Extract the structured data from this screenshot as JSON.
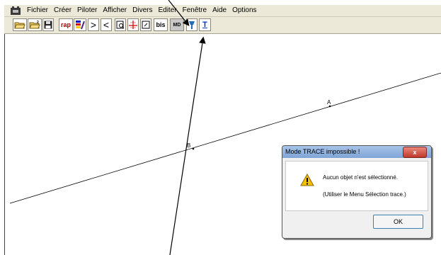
{
  "menubar": {
    "items": [
      "Fichier",
      "Créer",
      "Piloter",
      "Afficher",
      "Divers",
      "Editer",
      "Fenêtre",
      "Aide",
      "Options"
    ]
  },
  "toolbar": {
    "buttons": [
      {
        "name": "open-folder-icon",
        "label": ""
      },
      {
        "name": "open-folder-2-icon",
        "label": ""
      },
      {
        "name": "save-icon",
        "label": ""
      },
      {
        "name": "rap-button",
        "label": "rap"
      },
      {
        "name": "colors-icon",
        "label": ""
      },
      {
        "name": "greater-than-icon",
        "label": ">"
      },
      {
        "name": "less-than-icon",
        "label": "<"
      },
      {
        "name": "page-zoom-icon",
        "label": ""
      },
      {
        "name": "axes-icon",
        "label": ""
      },
      {
        "name": "frame-icon",
        "label": ""
      },
      {
        "name": "bis-button",
        "label": "bis"
      },
      {
        "name": "md-button",
        "label": "MD"
      },
      {
        "name": "pin-icon",
        "label": ""
      },
      {
        "name": "trace-icon",
        "label": "T"
      }
    ]
  },
  "canvas": {
    "points": [
      {
        "label": "A"
      },
      {
        "label": "B"
      }
    ]
  },
  "dialog": {
    "title": "Mode TRACE impossible !",
    "close_label": "x",
    "message": "Aucun objet n'est sélectionné.",
    "hint": "(Utiliser le Menu Sélection trace.)",
    "ok_label": "OK"
  }
}
